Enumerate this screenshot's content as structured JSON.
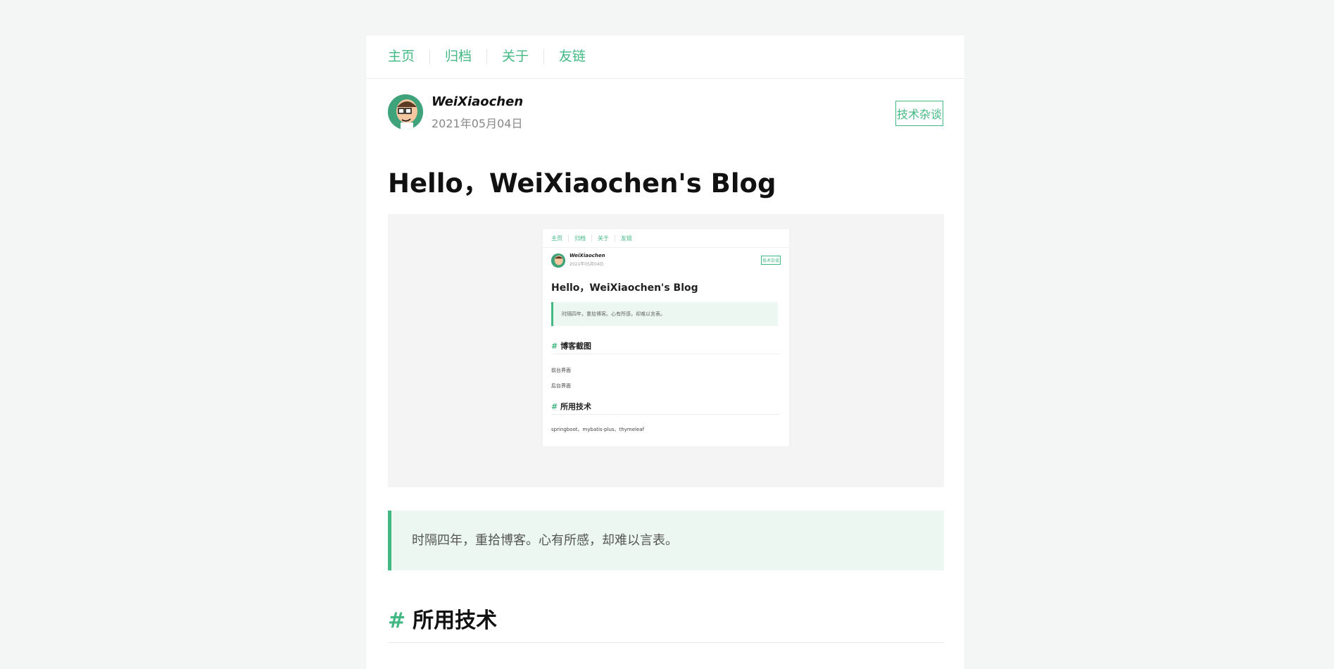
{
  "nav": {
    "items": [
      "主页",
      "归档",
      "关于",
      "友链"
    ]
  },
  "post": {
    "author": "WeiXiaochen",
    "date": "2021年05月04日",
    "category": "技术杂谈",
    "title": "Hello，WeiXiaochen's Blog",
    "quote": "时隔四年，重拾博客。心有所感，却难以言表。",
    "section_hash": "#",
    "section_title": "所用技术"
  },
  "screenshot": {
    "nav": [
      "主页",
      "归档",
      "关于",
      "友链"
    ],
    "author": "WeiXiaochen",
    "date": "2021年05月04日",
    "category": "技术杂谈",
    "title": "Hello，WeiXiaochen's Blog",
    "quote": "时隔四年，重拾博客。心有所感，却难以言表。",
    "h_screens": "博客截图",
    "front": "前台界面",
    "back": "后台界面",
    "h_tech": "所用技术",
    "tech": "springboot、mybatis-plus、thymeleaf"
  },
  "colors": {
    "accent": "#42b983",
    "quote_bg": "#ebf7f0",
    "page_bg": "#f4f6f5"
  }
}
